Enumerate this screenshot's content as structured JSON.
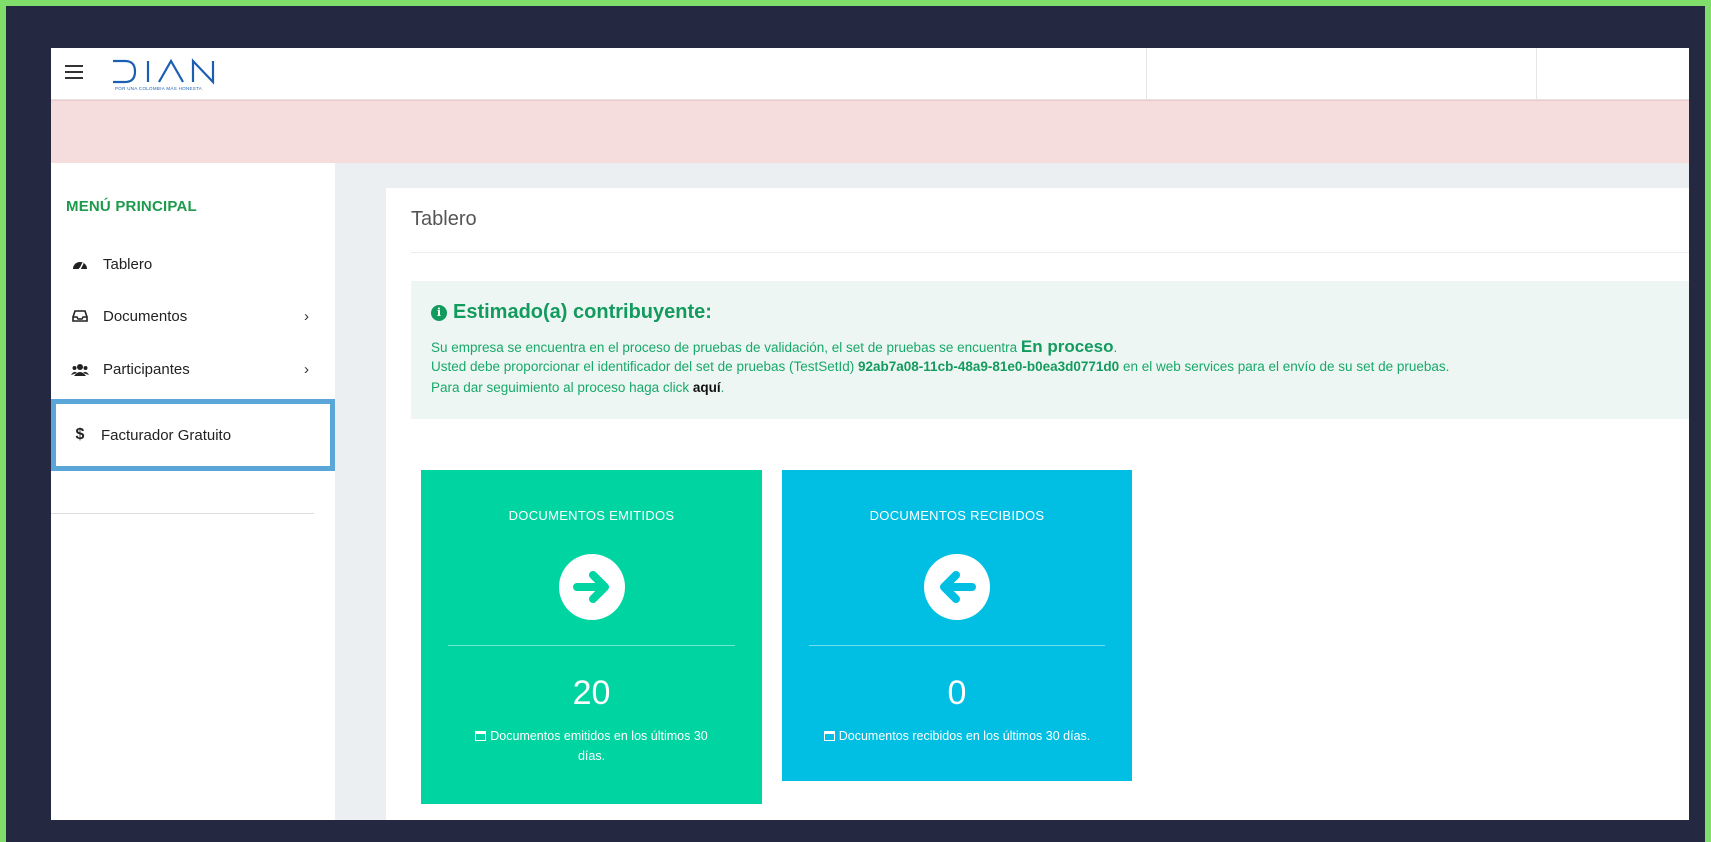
{
  "header": {
    "logo_text": "DIAN",
    "logo_tagline": "POR UNA COLOMBIA MÁS HONESTA"
  },
  "sidebar": {
    "menu_title": "MENÚ PRINCIPAL",
    "items": [
      {
        "label": "Tablero",
        "icon": "dashboard-icon",
        "has_submenu": false
      },
      {
        "label": "Documentos",
        "icon": "inbox-icon",
        "has_submenu": true
      },
      {
        "label": "Participantes",
        "icon": "users-icon",
        "has_submenu": true
      },
      {
        "label": "Facturador Gratuito",
        "icon": "dollar-icon",
        "has_submenu": false,
        "selected": true
      }
    ],
    "chevron": "›",
    "dollar_symbol": "$"
  },
  "main": {
    "page_title": "Tablero",
    "info": {
      "heading": "Estimado(a) contribuyente:",
      "line1_prefix": "Su empresa se encuentra en el proceso de pruebas de validación, el set de pruebas se encuentra ",
      "line1_status": "En proceso",
      "line1_suffix": ".",
      "line2_prefix": "Usted debe proporcionar el identificador del set de pruebas (TestSetId) ",
      "line2_id": "92ab7a08-11cb-48a9-81e0-b0ea3d0771d0",
      "line2_suffix": " en el web services para el envío de su set de pruebas.",
      "line3_prefix": "Para dar seguimiento al proceso haga click ",
      "line3_link": "aquí",
      "line3_suffix": "."
    },
    "cards": [
      {
        "title": "DOCUMENTOS EMITIDOS",
        "count": "20",
        "footer_line1": "Documentos emitidos en los últimos 30",
        "footer_line2": "días.",
        "icon": "arrow-right-circle-icon",
        "color": "#00d4a1"
      },
      {
        "title": "DOCUMENTOS RECIBIDOS",
        "count": "0",
        "footer": "Documentos recibidos en los últimos 30 días.",
        "icon": "arrow-left-circle-icon",
        "color": "#00bfe3"
      }
    ]
  },
  "colors": {
    "frame_border": "#7fdd6a",
    "background": "#252841",
    "accent_green": "#1e9a4d",
    "selection_outline": "#5ba6d8",
    "alert_band": "#f5dddd"
  }
}
